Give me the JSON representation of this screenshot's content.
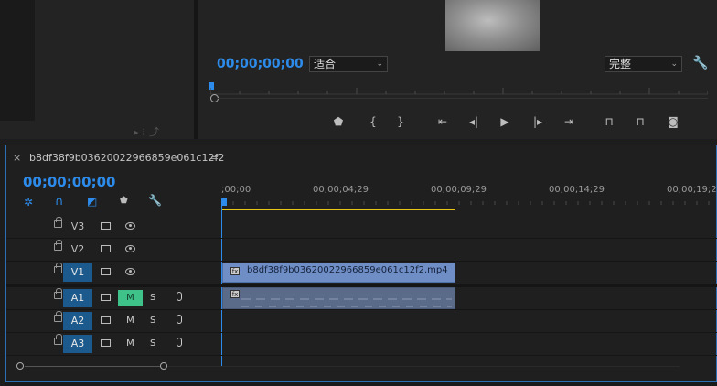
{
  "program_monitor": {
    "timecode": "00;00;00;00",
    "fit_dropdown": "适合",
    "quality_dropdown": "完整",
    "transport_buttons": [
      "add-marker",
      "mark-in",
      "mark-out",
      "go-to-in",
      "step-back",
      "play",
      "step-forward",
      "go-to-out",
      "lift",
      "extract",
      "export-frame"
    ]
  },
  "sequence": {
    "tab_close": "×",
    "tab_title": "b8df38f9b03620022966859e061c12f2",
    "tab_menu": "≡",
    "timecode": "00;00;00;00",
    "ruler_labels": [
      ";00;00",
      "00;00;04;29",
      "00;00;09;29",
      "00;00;14;29",
      "00;00;19;2"
    ],
    "video_tracks": [
      {
        "label": "V3",
        "active": false
      },
      {
        "label": "V2",
        "active": false
      },
      {
        "label": "V1",
        "active": true
      }
    ],
    "audio_tracks": [
      {
        "label": "A1",
        "active": true,
        "mute": "M",
        "solo": "S",
        "mute_on": true
      },
      {
        "label": "A2",
        "active": true,
        "mute": "M",
        "solo": "S",
        "mute_on": false
      },
      {
        "label": "A3",
        "active": true,
        "mute": "M",
        "solo": "S",
        "mute_on": false
      }
    ],
    "video_clip": "b8df38f9b03620022966859e061c12f2.mp4",
    "fx_badge": "fx"
  },
  "colors": {
    "accent_blue": "#2d8ceb",
    "mute_green": "#3ec28a",
    "work_area_yellow": "#e6c619",
    "video_clip": "#6f8ec6"
  }
}
